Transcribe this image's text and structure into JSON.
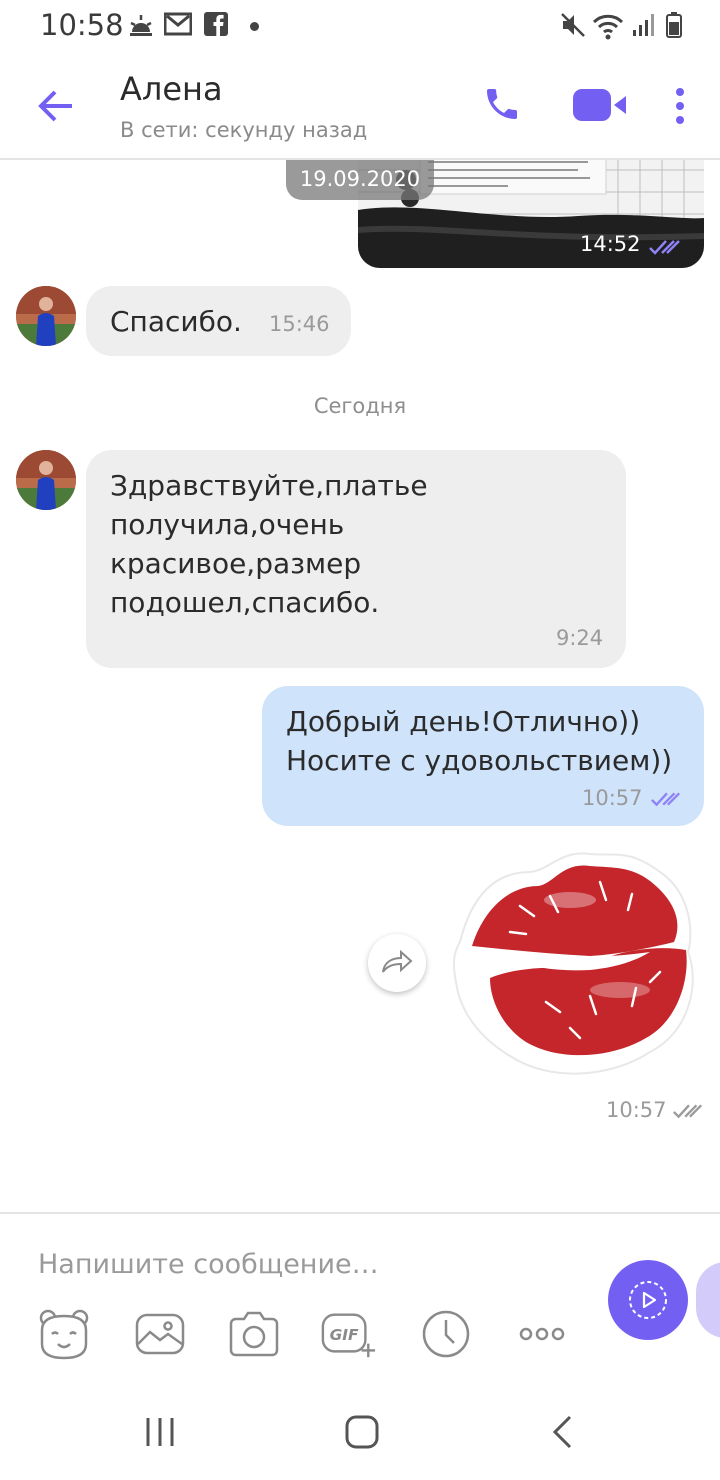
{
  "status_bar": {
    "time": "10:58",
    "icons": [
      "weather-icon",
      "gmail-icon",
      "facebook-icon",
      "notification-dot-icon",
      "mute-icon",
      "wifi-icon",
      "signal-icon",
      "battery-icon"
    ]
  },
  "header": {
    "contact_name": "Алена",
    "contact_status": "В сети: секунду назад",
    "icons": [
      "back-arrow-icon",
      "phone-icon",
      "video-call-icon",
      "more-vert-icon"
    ],
    "accent_color": "#7360f2"
  },
  "chat": {
    "photo_message": {
      "date_label": "19.09.2020",
      "time": "14:52",
      "read": true
    },
    "messages_before": [
      {
        "direction": "in",
        "text": "Спасибо.",
        "time": "15:46"
      }
    ],
    "day_separator": "Сегодня",
    "messages_today": [
      {
        "direction": "in",
        "lines": [
          "Здравствуйте,платье",
          "получила,очень",
          "красивое,размер",
          "подошел,спасибо."
        ],
        "time": "9:24"
      },
      {
        "direction": "out",
        "lines": [
          "Добрый день!Отлично))",
          "Носите с удовольствием))"
        ],
        "time": "10:57",
        "read": true
      },
      {
        "direction": "out",
        "type": "sticker",
        "sticker": "red-lips-kiss-sticker",
        "time": "10:57",
        "read": true
      }
    ]
  },
  "composer": {
    "placeholder": "Напишите сообщение…",
    "tools": [
      "sticker-bear-icon",
      "gallery-icon",
      "camera-icon",
      "gif-icon",
      "timer-icon",
      "more-horiz-icon"
    ]
  },
  "nav_bar": {
    "icons": [
      "recent-apps-icon",
      "home-icon",
      "back-icon"
    ]
  }
}
